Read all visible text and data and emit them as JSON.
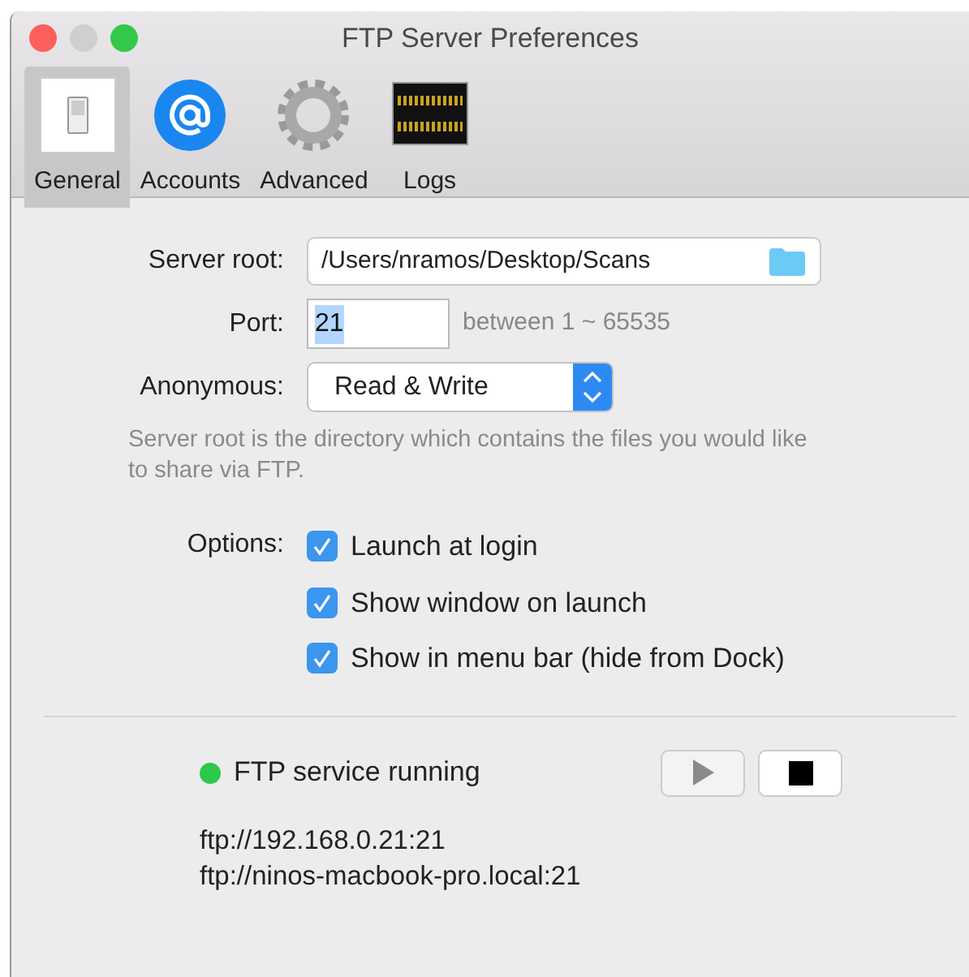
{
  "window": {
    "title": "FTP Server Preferences"
  },
  "toolbar": [
    {
      "kind": "switch",
      "label": "General",
      "selected": true
    },
    {
      "kind": "at",
      "label": "Accounts",
      "selected": false
    },
    {
      "kind": "gear",
      "label": "Advanced",
      "selected": false
    },
    {
      "kind": "log",
      "label": "Logs",
      "selected": false
    }
  ],
  "server_root": {
    "label": "Server root:",
    "value": "/Users/nramos/Desktop/Scans"
  },
  "port": {
    "label": "Port:",
    "value": "21",
    "hint": "between 1 ~ 65535"
  },
  "anonymous": {
    "label": "Anonymous:",
    "value": "Read & Write"
  },
  "description": "Server root is the directory which contains the files you would like to share via FTP.",
  "options": {
    "label": "Options:",
    "items": [
      {
        "label": "Launch at login",
        "checked": true
      },
      {
        "label": "Show window on launch",
        "checked": true
      },
      {
        "label": "Show in menu bar (hide from Dock)",
        "checked": true
      }
    ]
  },
  "status": {
    "text": "FTP service running",
    "running": true
  },
  "controls": [
    {
      "kind": "play",
      "disabled": true
    },
    {
      "kind": "stop",
      "disabled": false
    }
  ],
  "urls": [
    "ftp://192.168.0.21:21",
    "ftp://ninos-macbook-pro.local:21"
  ]
}
